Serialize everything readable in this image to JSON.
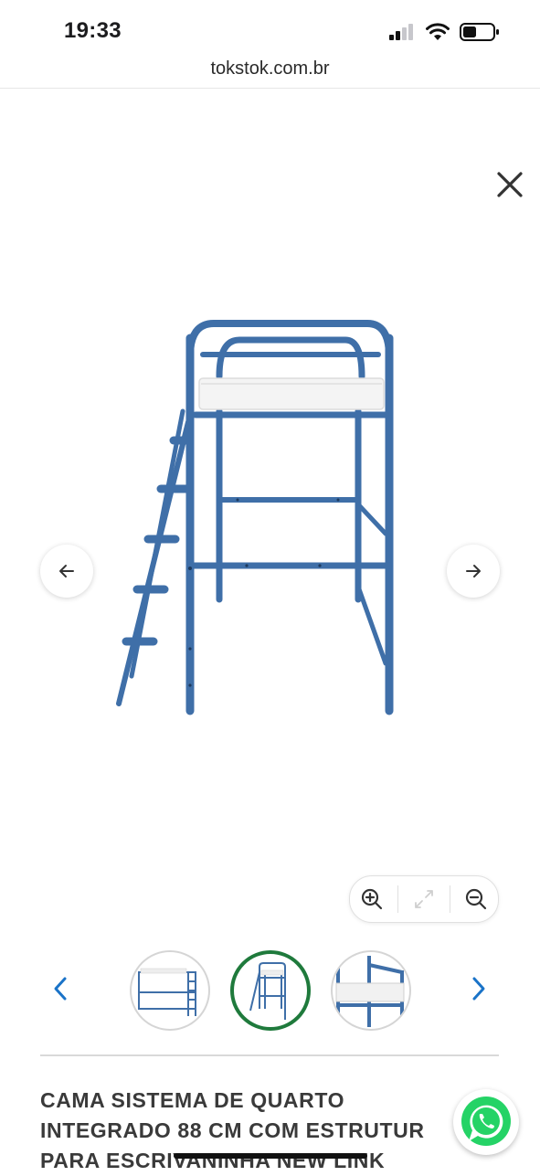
{
  "status_bar": {
    "time": "19:33",
    "icons": [
      "signal-icon",
      "wifi-icon",
      "battery-icon"
    ]
  },
  "browser": {
    "url": "tokstok.com.br"
  },
  "gallery": {
    "close_icon": "close-icon",
    "prev_icon": "arrow-left-icon",
    "next_icon": "arrow-right-icon",
    "image_subject": "blue metal loft bed with ladder",
    "product_color": "#3f6fa8"
  },
  "zoom_controls": {
    "buttons": [
      "zoom-in-icon",
      "fullscreen-icon",
      "zoom-out-icon"
    ],
    "fullscreen_enabled": false
  },
  "thumbnails": {
    "count": 3,
    "active_index": 1,
    "active_color": "#1f7a3c",
    "prev_icon": "chevron-left-icon",
    "next_icon": "chevron-right-icon",
    "arrow_color": "#1a73c8"
  },
  "product": {
    "title_line1": "CAMA SISTEMA DE QUARTO",
    "title_line2": "INTEGRADO 88 CM COM ESTRUTUR",
    "title_line3": "PARA ESCRIVANINHA NEW LINK"
  },
  "whatsapp": {
    "icon": "whatsapp-icon",
    "color": "#25d366"
  }
}
